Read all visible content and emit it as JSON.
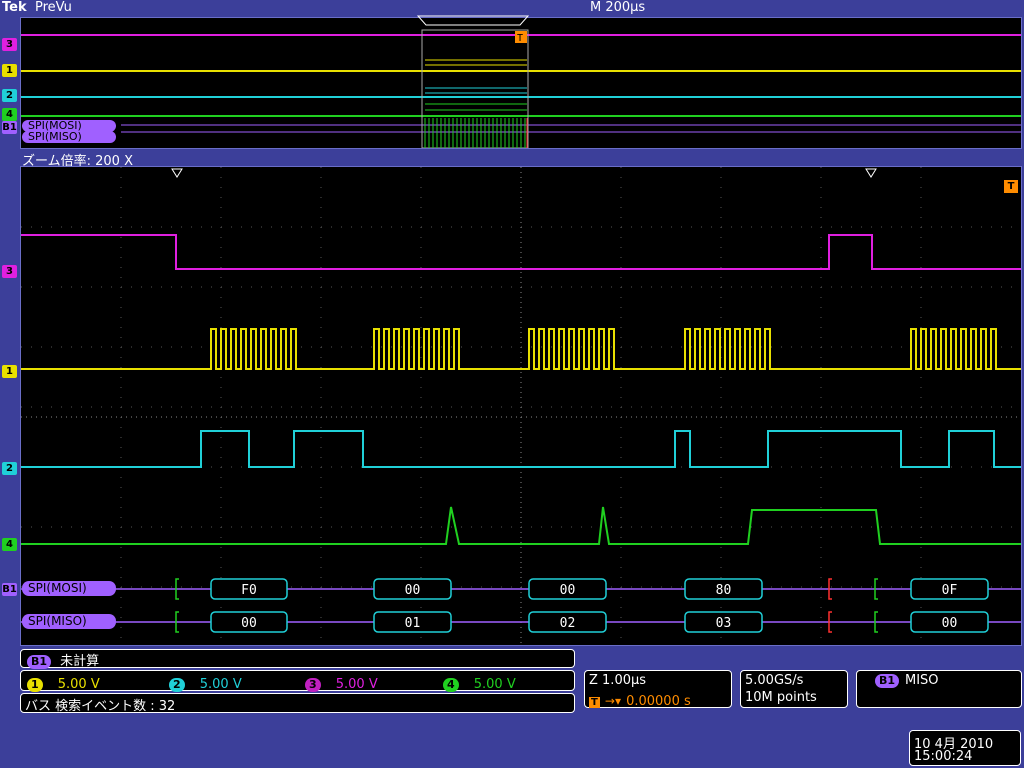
{
  "header": {
    "brand": "Tek",
    "mode": "PreVu",
    "timebase": "M 200µs"
  },
  "zoom": {
    "label": "ズーム倍率: 200 X"
  },
  "channels": [
    {
      "id": "3",
      "color": "#e020e0"
    },
    {
      "id": "1",
      "color": "#e8e000"
    },
    {
      "id": "2",
      "color": "#20d0d8"
    },
    {
      "id": "4",
      "color": "#20d020"
    }
  ],
  "bus": {
    "marker": "B1",
    "mosi_label": "SPI(MOSI)",
    "miso_label": "SPI(MISO)",
    "mosi_values": [
      "F0",
      "00",
      "00",
      "80",
      "0F"
    ],
    "miso_values": [
      "00",
      "01",
      "02",
      "03",
      "00"
    ]
  },
  "status": {
    "b1_text": "未計算",
    "search_events": "バス 検索イベント数 : 32"
  },
  "scales": [
    {
      "ch": "1",
      "value": "5.00 V",
      "color": "#e8e000"
    },
    {
      "ch": "2",
      "value": "5.00 V",
      "color": "#20d0d8"
    },
    {
      "ch": "3",
      "value": "5.00 V",
      "color": "#e020e0"
    },
    {
      "ch": "4",
      "value": "5.00 V",
      "color": "#20d020"
    }
  ],
  "horizontal": {
    "zoom_scale": "Z 1.00µs",
    "trigger_pos": "0.00000 s"
  },
  "acquisition": {
    "rate": "5.00GS/s",
    "points": "10M points"
  },
  "trigger": {
    "source_badge": "B1",
    "source": "MISO",
    "marker": "T"
  },
  "datetime": {
    "date": "10 4月  2010",
    "time": "15:00:24"
  }
}
